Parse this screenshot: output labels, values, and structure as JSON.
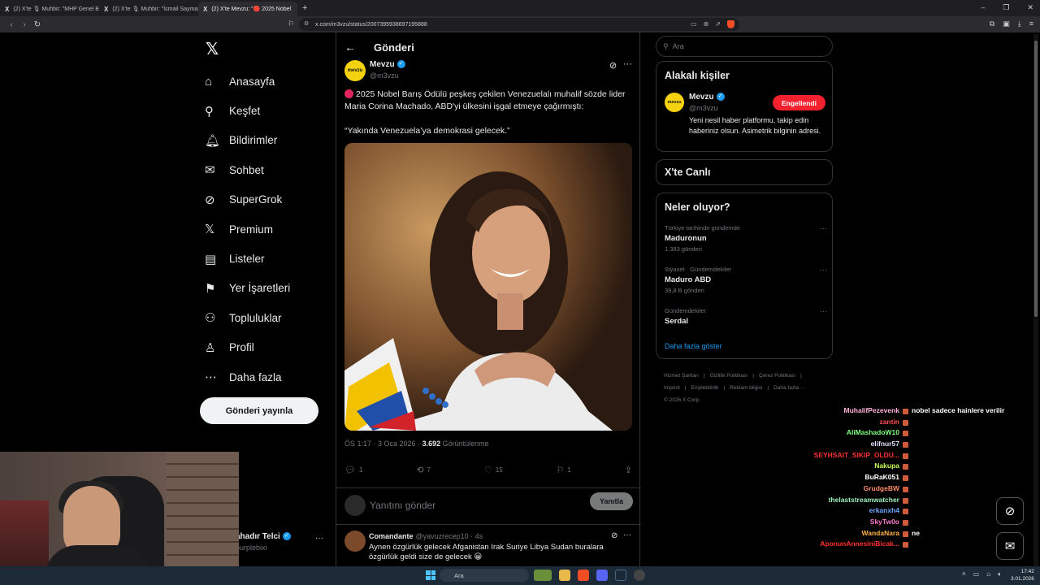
{
  "browser": {
    "tabs": [
      {
        "label": "(2) X'te 🎙 Muhbir: \"MHP Genel Baş"
      },
      {
        "label": "(2) X'te 🎙 Muhbir: \"İsmail Saymaz:"
      },
      {
        "label": "(2) X'te Mevzu: \"🔴 2025 Nobel"
      }
    ],
    "url": "x.com/m3vzu/status/2007395938697195888"
  },
  "nav": {
    "items": [
      {
        "label": "Anasayfa",
        "icon": "⌂"
      },
      {
        "label": "Keşfet",
        "icon": "⚲"
      },
      {
        "label": "Bildirimler",
        "icon": "🔔︎"
      },
      {
        "label": "Sohbet",
        "icon": "✉"
      },
      {
        "label": "SuperGrok",
        "icon": "⊘"
      },
      {
        "label": "Premium",
        "icon": "𝕏"
      },
      {
        "label": "Listeler",
        "icon": "▤"
      },
      {
        "label": "Yer İşaretleri",
        "icon": "⚑"
      },
      {
        "label": "Topluluklar",
        "icon": "⚇"
      },
      {
        "label": "Profil",
        "icon": "♙"
      },
      {
        "label": "Daha fazla",
        "icon": "⋯"
      }
    ],
    "post_button": "Gönderi yayınla",
    "account_name": "ahadır Telci",
    "account_handle": "purplebixi"
  },
  "header": {
    "title": "Gönderi"
  },
  "tweet": {
    "author_name": "Mevzu",
    "author_handle": "@m3vzu",
    "avatar_text": "mevzu",
    "text_line1": "2025 Nobel Barış Ödülü peşkeş çekilen Venezuelalı muhalif sözde lider Maria Corina Machado, ABD'yi ülkesini işgal etmeye çağırmıştı:",
    "text_line2": "“Yakında Venezuela’ya demokrasi gelecek.”",
    "time": "ÖS 1:17 · 3 Oca 2026 · ",
    "views": "3.692",
    "views_label": " Görüntülenme",
    "replies": "1",
    "reposts": "7",
    "likes": "15",
    "bookmarks": "1"
  },
  "reply_box": {
    "placeholder": "Yanıtını gönder",
    "button": "Yanıtla"
  },
  "comment": {
    "name": "Comandante",
    "handle": "@yavuzrecep10 · 4s",
    "text": "Aynen özgürlük gelecek Afganistan Irak Suriye Libya Sudan buralara özgürlük geldi size de gelecek 😀"
  },
  "search": {
    "placeholder": "Ara"
  },
  "related": {
    "title": "Alakalı kişiler",
    "name": "Mevzu",
    "handle": "@m3vzu",
    "button": "Engellendi",
    "bio": "Yeni nesil haber platformu, takip edin haberiniz olsun. Asimetrik bilginin adresi."
  },
  "live": {
    "title": "X'te Canlı"
  },
  "trends": {
    "title": "Neler oluyor?",
    "items": [
      {
        "context": "Türkiye tarihinde gündemde",
        "topic": "Maduronun",
        "posts": "1.383 gönderi"
      },
      {
        "context": "Siyaset · Gündemdekiler",
        "topic": "Maduro ABD",
        "posts": "39,8 B gönderi"
      },
      {
        "context": "Gündemdekiler",
        "topic": "Serdal",
        "posts": ""
      }
    ],
    "more": "Daha fazla göster"
  },
  "footer": {
    "links": [
      "Hizmet Şartları",
      "|",
      "Gizlilik Politikası",
      "|",
      "Çerez Politikası",
      "|",
      "Imprint",
      "|",
      "Erişilebilirlik",
      "|",
      "Reklam bilgisi",
      "|",
      "Daha fazla ···"
    ],
    "copyright": "© 2026 X Corp."
  },
  "chat": [
    {
      "user": "MuhalifPezevenk",
      "color": "#ffb3d9",
      "msg": "nobel sadece hainlere verilir"
    },
    {
      "user": "zantin",
      "color": "#ff4d4d",
      "msg": ""
    },
    {
      "user": "AliMashadoW10",
      "color": "#7fff7f",
      "msg": ""
    },
    {
      "user": "elifnur57",
      "color": "#e0e0ff",
      "msg": ""
    },
    {
      "user": "SEYHSAIT_SIKIP_OLDU...",
      "color": "#ff3030",
      "msg": ""
    },
    {
      "user": "Nakupa",
      "color": "#c8ff5a",
      "msg": ""
    },
    {
      "user": "BuRaK051",
      "color": "#ffffff",
      "msg": ""
    },
    {
      "user": "GrudgeBW",
      "color": "#ff8c69",
      "msg": ""
    },
    {
      "user": "thelaststreamwatcher",
      "color": "#9ff0c0",
      "msg": ""
    },
    {
      "user": "erkanxh4",
      "color": "#6fa8ff",
      "msg": ""
    },
    {
      "user": "SkyTw0o",
      "color": "#ff77cc",
      "msg": ""
    },
    {
      "user": "WandaNara",
      "color": "#ffb347",
      "msg": "ne"
    },
    {
      "user": "AponunAnnesiniBicak...",
      "color": "#ff3030",
      "msg": ""
    }
  ],
  "taskbar": {
    "search": "Ara",
    "time": "17:42",
    "date": "3.01.2026"
  }
}
